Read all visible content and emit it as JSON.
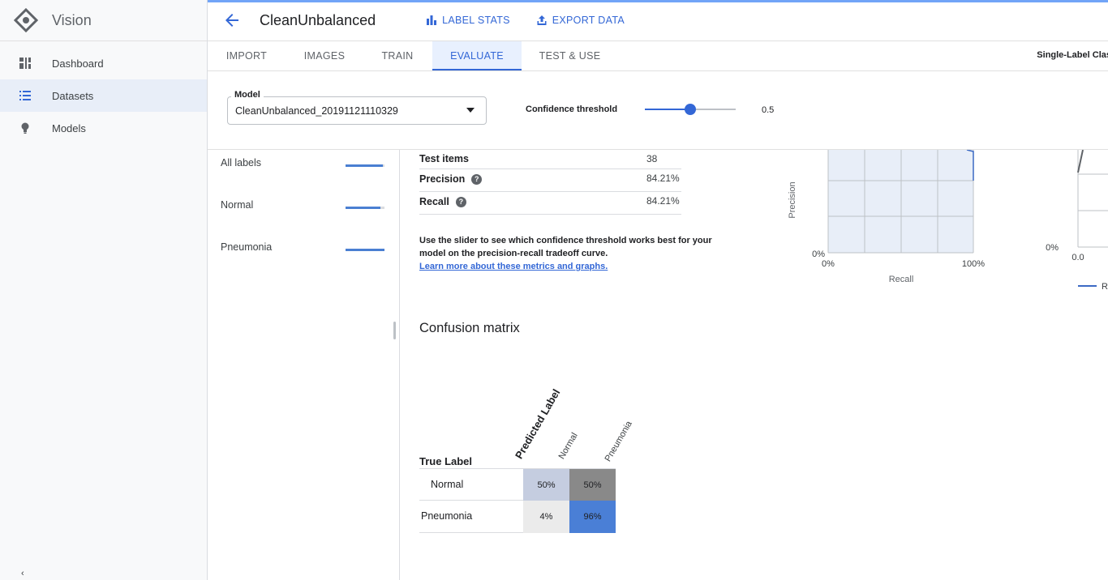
{
  "app": {
    "name": "Vision"
  },
  "sidebar": {
    "items": [
      {
        "label": "Dashboard",
        "active": false
      },
      {
        "label": "Datasets",
        "active": true
      },
      {
        "label": "Models",
        "active": false
      }
    ],
    "bottom_glyph": "‹"
  },
  "header": {
    "dataset_title": "CleanUnbalanced",
    "actions": {
      "label_stats": "LABEL STATS",
      "export_data": "EXPORT DATA"
    }
  },
  "tabs": {
    "items": [
      "IMPORT",
      "IMAGES",
      "TRAIN",
      "EVALUATE",
      "TEST & USE"
    ],
    "active": "EVALUATE",
    "model_type": "Single-Label Clas"
  },
  "model_selector": {
    "label": "Model",
    "value": "CleanUnbalanced_20191121110329",
    "confidence_label": "Confidence threshold",
    "confidence_value": 0.5,
    "confidence_text": "0.5"
  },
  "labels": {
    "items": [
      {
        "name": "All labels",
        "score": 0.96
      },
      {
        "name": "Normal",
        "score": 0.9
      },
      {
        "name": "Pneumonia",
        "score": 1.0
      }
    ]
  },
  "metrics": {
    "rows": [
      {
        "label": "Test items",
        "value": "38",
        "help": false
      },
      {
        "label": "Precision",
        "value": "84.21%",
        "help": true
      },
      {
        "label": "Recall",
        "value": "84.21%",
        "help": true
      }
    ],
    "hint": "Use the slider to see which confidence threshold works best for your model on the precision-recall tradeoff curve.",
    "learn_more": "Learn more about these metrics and graphs."
  },
  "pr_chart": {
    "ylabel": "Precision",
    "xlabel": "Recall",
    "x_ticks": [
      "0%",
      "100%"
    ],
    "y_tick_min": "0%"
  },
  "threshold_chart": {
    "y_tick_min": "0%",
    "x_tick_min": "0.0",
    "legend_initial": "R"
  },
  "confusion_matrix": {
    "title": "Confusion matrix",
    "true_label_title": "True Label",
    "predicted_label_title": "Predicted Label",
    "columns": [
      "Normal",
      "Pneumonia"
    ],
    "rows": [
      {
        "label": "Normal",
        "values": [
          "50%",
          "50%"
        ]
      },
      {
        "label": "Pneumonia",
        "values": [
          "4%",
          "96%"
        ]
      }
    ],
    "colors": {
      "light": "#c5cde0",
      "gray": "#898989",
      "pale": "#ebebeb",
      "blue": "#4a7fd6"
    }
  },
  "colors": {
    "accent": "#3367d6",
    "sidebar_bg": "#f8f9fa"
  }
}
